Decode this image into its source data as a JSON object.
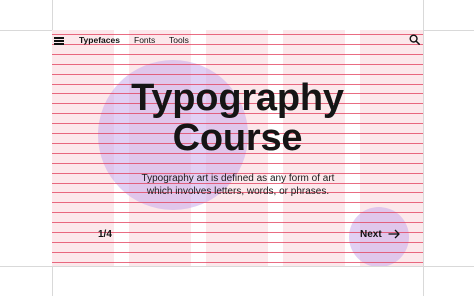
{
  "nav": {
    "menu_icon": "hamburger-icon",
    "items": [
      {
        "label": "Typefaces",
        "active": true
      },
      {
        "label": "Fonts",
        "active": false
      },
      {
        "label": "Tools",
        "active": false
      }
    ],
    "search_icon": "search-icon"
  },
  "hero": {
    "title_line_1": "Typography",
    "title_line_2": "Course",
    "description": "Typography art is defined as any form of art which involves letters, words, or phrases."
  },
  "footer": {
    "pager": "1/4",
    "next_label": "Next",
    "next_icon": "arrow-right-icon"
  },
  "colors": {
    "grid_column": "#f5c9d1",
    "baseline": "#e13c5a",
    "accent_circle": "#c8aaeb",
    "text": "#151515",
    "frame_line": "#d9d9d9"
  }
}
